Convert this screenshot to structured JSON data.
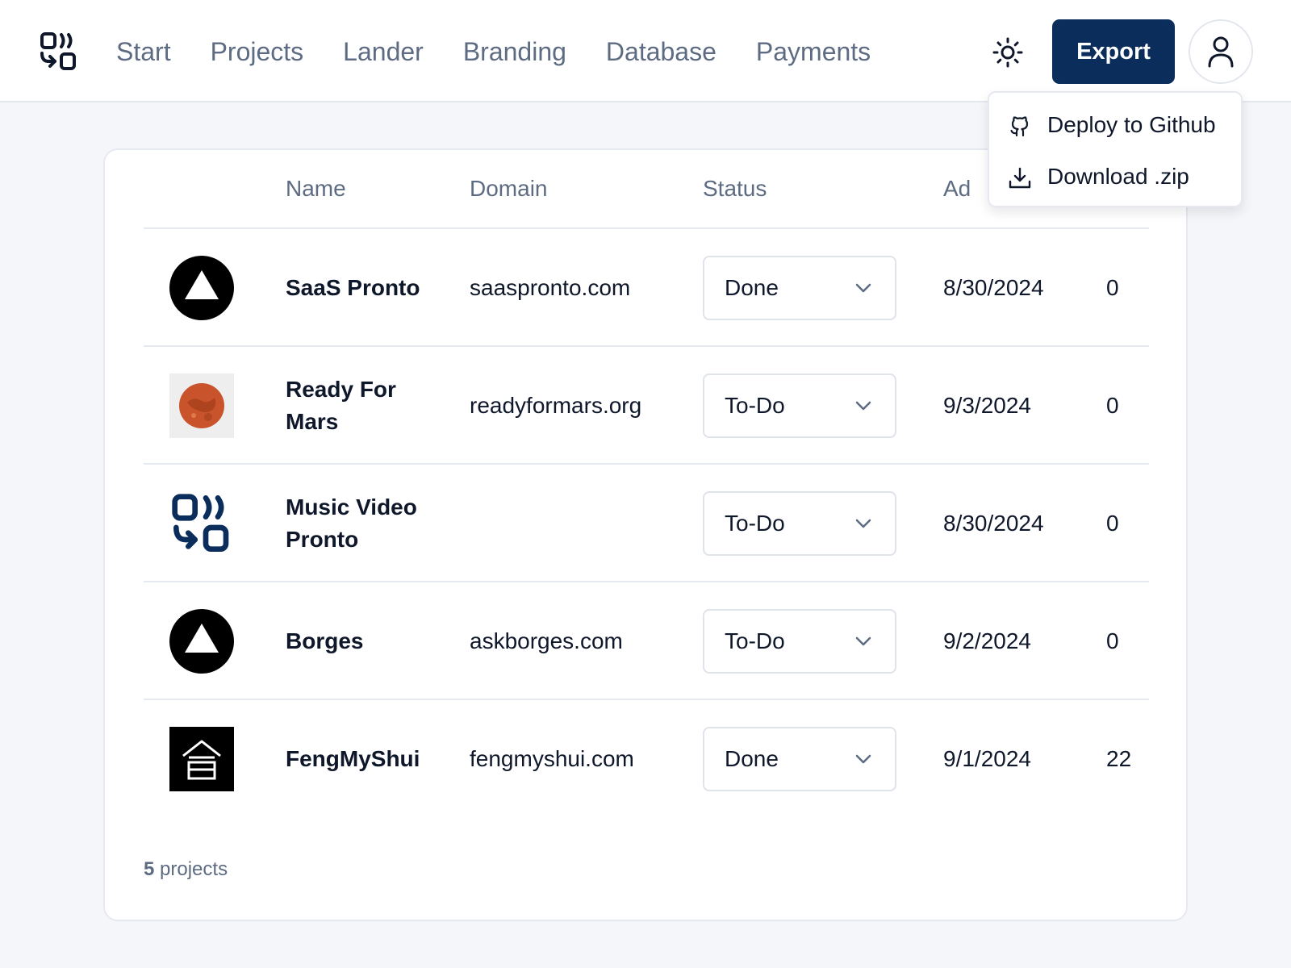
{
  "nav": {
    "items": [
      {
        "label": "Start"
      },
      {
        "label": "Projects"
      },
      {
        "label": "Lander"
      },
      {
        "label": "Branding"
      },
      {
        "label": "Database"
      },
      {
        "label": "Payments"
      }
    ]
  },
  "header": {
    "theme_icon": "sun-icon",
    "export_label": "Export",
    "user_icon": "user-icon"
  },
  "export_menu": {
    "items": [
      {
        "label": "Deploy to Github",
        "icon": "github-icon"
      },
      {
        "label": "Download .zip",
        "icon": "download-icon"
      }
    ]
  },
  "table": {
    "columns": [
      "Name",
      "Domain",
      "Status",
      "Ad"
    ],
    "rows": [
      {
        "logo": "triangle-logo",
        "name": "SaaS Pronto",
        "domain": "saaspronto.com",
        "status": "Done",
        "date": "8/30/2024",
        "count": "0"
      },
      {
        "logo": "mars-logo",
        "name": "Ready For Mars",
        "domain": "readyformars.org",
        "status": "To-Do",
        "date": "9/3/2024",
        "count": "0"
      },
      {
        "logo": "app-logo",
        "name": "Music Video Pronto",
        "domain": "",
        "status": "To-Do",
        "date": "8/30/2024",
        "count": "0"
      },
      {
        "logo": "triangle-logo",
        "name": "Borges",
        "domain": "askborges.com",
        "status": "To-Do",
        "date": "9/2/2024",
        "count": "0"
      },
      {
        "logo": "pagoda-logo",
        "name": "FengMyShui",
        "domain": "fengmyshui.com",
        "status": "Done",
        "date": "9/1/2024",
        "count": "22"
      }
    ]
  },
  "footer": {
    "count": "5",
    "count_label": "projects"
  },
  "colors": {
    "primary": "#0a2d5b",
    "muted_text": "#5d6b83",
    "border": "#e6e9ef",
    "background": "#f5f6f9",
    "mars_orange": "#c9532a"
  }
}
